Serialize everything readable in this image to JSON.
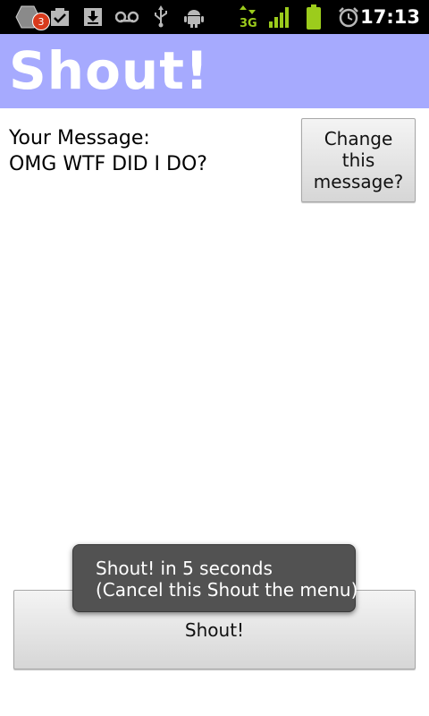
{
  "status_bar": {
    "notification_count": "3",
    "time": "17:13",
    "icons": [
      "app-notification-icon",
      "task-check-icon",
      "download-icon",
      "voicemail-icon",
      "usb-icon",
      "android-debug-icon",
      "3g-data-icon",
      "signal-strength-icon",
      "battery-icon",
      "alarm-icon"
    ],
    "accent_color": "#9ccc1c"
  },
  "app": {
    "title": "Shout!",
    "title_bar_color": "#a6aafe"
  },
  "message": {
    "label": "Your Message:",
    "value": "OMG WTF DID I DO?"
  },
  "buttons": {
    "change_message_label": "Change this message?",
    "shout_label": "Shout!"
  },
  "toast": {
    "line1": "Shout! in 5 seconds",
    "line2": "(Cancel this Shout the menu)"
  }
}
